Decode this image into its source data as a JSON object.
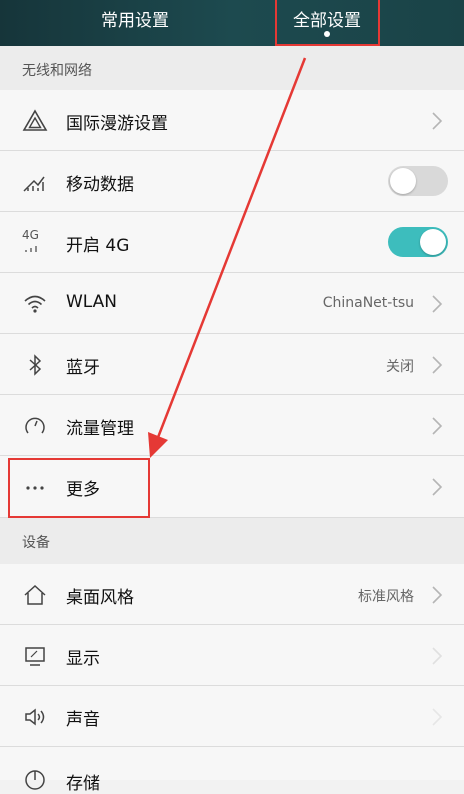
{
  "tabs": {
    "common_label": "常用设置",
    "all_label": "全部设置"
  },
  "sections": {
    "wireless": "无线和网络",
    "device": "设备"
  },
  "rows": {
    "roaming": {
      "label": "国际漫游设置",
      "icon": "roaming-icon"
    },
    "mobile_data": {
      "label": "移动数据",
      "icon": "mobile-data-icon",
      "toggle": "off"
    },
    "enable_4g": {
      "label": "开启 4G",
      "icon": "4g-icon",
      "icon_text": "4G",
      "toggle": "on"
    },
    "wlan": {
      "label": "WLAN",
      "icon": "wifi-icon",
      "value": "ChinaNet-tsu"
    },
    "bluetooth": {
      "label": "蓝牙",
      "icon": "bluetooth-icon",
      "value": "关闭"
    },
    "data_usage": {
      "label": "流量管理",
      "icon": "data-usage-icon"
    },
    "more": {
      "label": "更多",
      "icon": "more-icon"
    },
    "home_style": {
      "label": "桌面风格",
      "icon": "home-icon",
      "value": "标准风格"
    },
    "display": {
      "label": "显示",
      "icon": "display-icon"
    },
    "sound": {
      "label": "声音",
      "icon": "speaker-icon"
    },
    "storage": {
      "label": "存储",
      "icon": "storage-icon"
    }
  },
  "colors": {
    "toggle_on": "#3dbdbd",
    "highlight": "#e53935",
    "topbar": "#1d4a4f"
  }
}
